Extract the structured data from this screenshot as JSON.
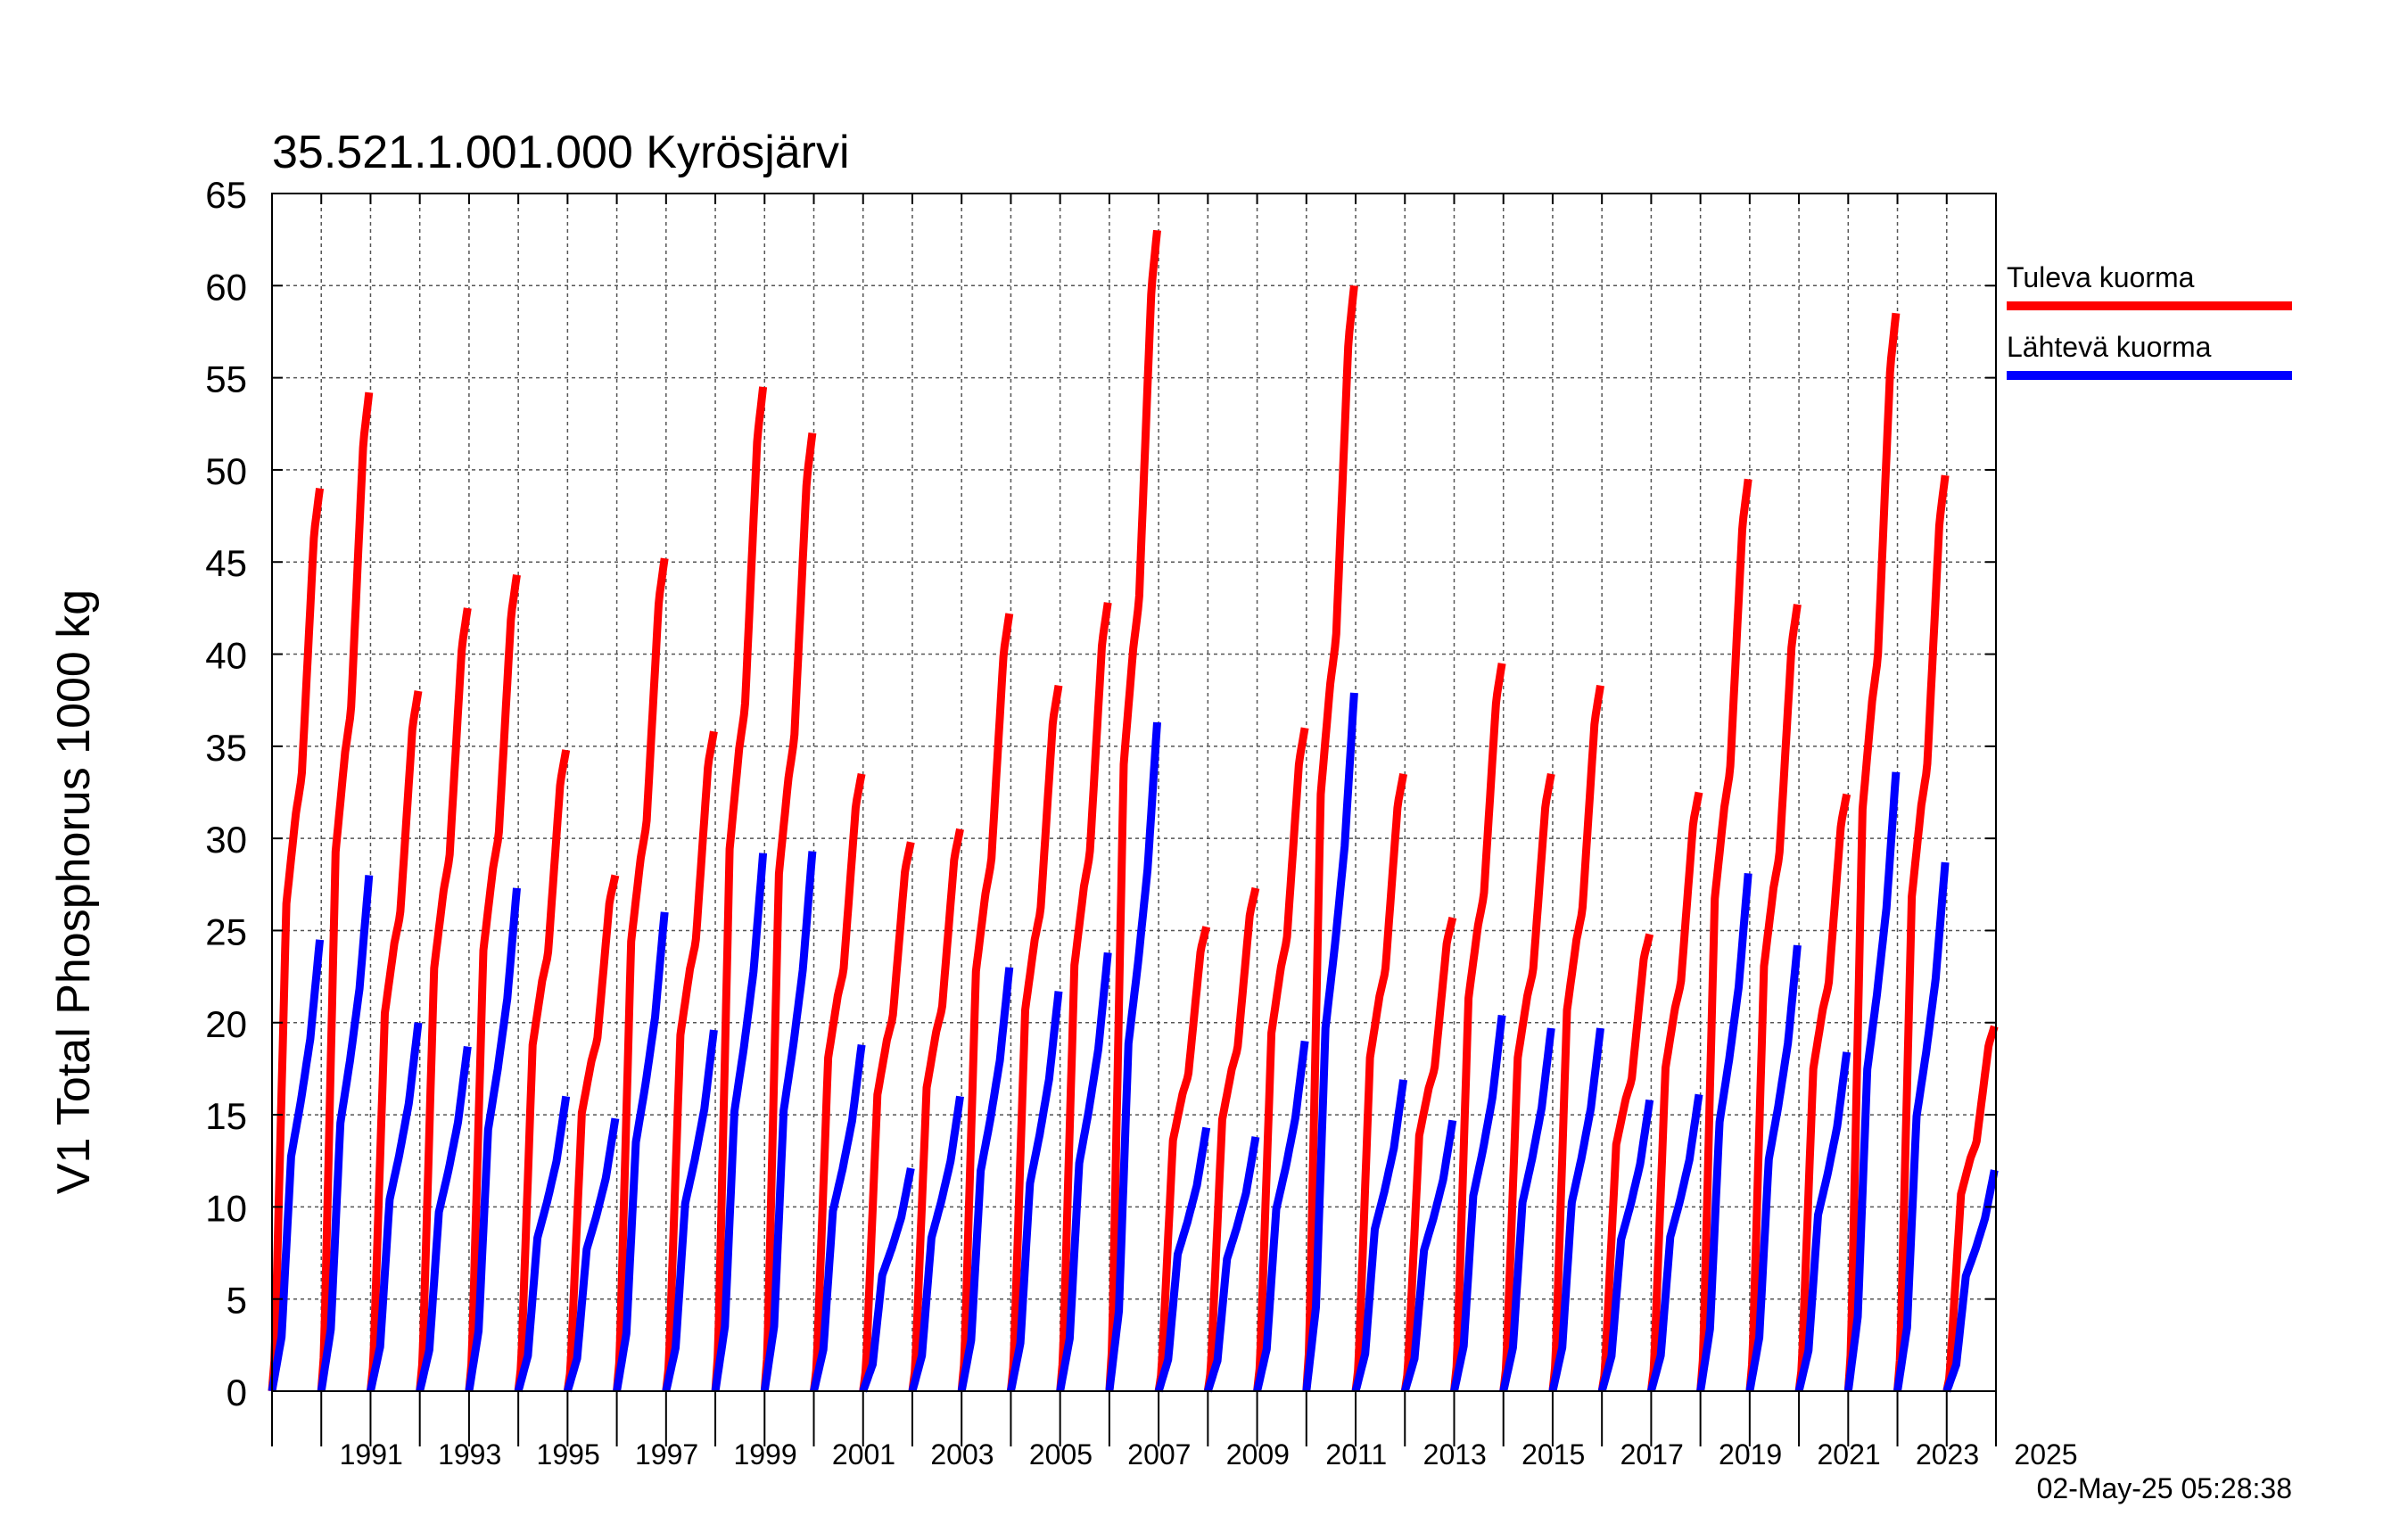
{
  "chart_data": {
    "type": "line",
    "title": "35.521.1.001.000 Kyrösjärvi",
    "ylabel": "V1 Total Phosphorus 1000 kg",
    "xlabel": "",
    "xlim": [
      1990,
      2025
    ],
    "ylim": [
      0,
      65
    ],
    "yticks": [
      0,
      5,
      10,
      15,
      20,
      25,
      30,
      35,
      40,
      45,
      50,
      55,
      60,
      65
    ],
    "xtick_labels": [
      "1991",
      "1993",
      "1995",
      "1997",
      "1999",
      "2001",
      "2003",
      "2005",
      "2007",
      "2009",
      "2011",
      "2013",
      "2015",
      "2017",
      "2019",
      "2021",
      "2023",
      "2025"
    ],
    "grid": true,
    "legend_position": "right",
    "timestamp": "02-May-25 05:28:38",
    "series": [
      {
        "name": "Tuleva kuorma",
        "color": "#ff0000",
        "annual_totals": [
          49.0,
          54.2,
          38.0,
          42.5,
          44.3,
          34.8,
          28.0,
          45.2,
          35.8,
          54.5,
          52.0,
          33.5,
          29.8,
          30.5,
          42.2,
          38.3,
          42.8,
          63.0,
          25.2,
          27.3,
          36.0,
          60.0,
          33.5,
          25.7,
          39.5,
          33.5,
          38.3,
          24.8,
          32.5,
          49.5,
          42.7,
          32.4,
          58.5,
          49.7,
          19.8
        ]
      },
      {
        "name": "Lähtevä kuorma",
        "color": "#0000ff",
        "annual_totals": [
          24.5,
          28.0,
          20.0,
          18.7,
          27.3,
          16.0,
          14.8,
          26.0,
          19.6,
          29.2,
          29.3,
          18.8,
          12.1,
          16.0,
          23.0,
          21.7,
          23.8,
          36.3,
          14.3,
          13.8,
          19.0,
          37.9,
          16.9,
          14.7,
          20.4,
          19.7,
          19.7,
          15.8,
          16.1,
          28.1,
          24.2,
          18.4,
          33.6,
          28.7,
          12.0
        ]
      }
    ]
  }
}
